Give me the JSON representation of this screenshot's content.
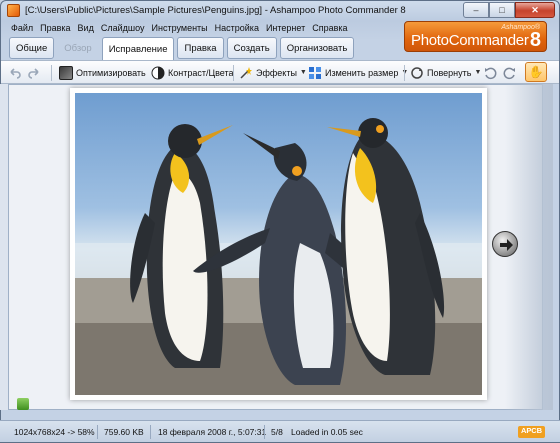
{
  "window": {
    "title": "[C:\\Users\\Public\\Pictures\\Sample Pictures\\Penguins.jpg] - Ashampoo Photo Commander 8",
    "controls": {
      "minimize": "‒",
      "maximize": "□",
      "close": "✕"
    }
  },
  "menu": {
    "items": [
      "Файл",
      "Правка",
      "Вид",
      "Слайдшоу",
      "Инструменты",
      "Настройка",
      "Интернет",
      "Справка"
    ]
  },
  "tabs": [
    {
      "label": "Общие",
      "state": "normal"
    },
    {
      "label": "Обзор",
      "state": "disabled"
    },
    {
      "label": "Исправление",
      "state": "active"
    },
    {
      "label": "Правка",
      "state": "normal"
    },
    {
      "label": "Создать",
      "state": "normal"
    },
    {
      "label": "Организовать",
      "state": "normal"
    }
  ],
  "logo": {
    "brand": "Ashampoo®",
    "product": "PhotoCommander",
    "version": "8"
  },
  "toolbar": {
    "optimize": "Оптимизировать",
    "contrast": "Контраст/Цвета",
    "effects": "Эффекты",
    "resize": "Изменить размер",
    "rotate": "Повернуть"
  },
  "icons": {
    "undo": "undo-icon",
    "redo": "redo-icon",
    "optimize": "wand-icon",
    "contrast": "contrast-icon",
    "effects": "effects-icon",
    "resize": "resize-icon",
    "rotate": "rotate-icon",
    "rotate_left": "rotate-left-icon",
    "rotate_right": "rotate-right-icon",
    "hand": "hand-icon",
    "next": "next-arrow-icon"
  },
  "status": {
    "dimensions": "1024x768x24 -> 58%",
    "size": "759.60 KB",
    "date": "18 февраля 2008 г., 5:07:31",
    "position": "5/8",
    "load": "Loaded in 0.05 sec",
    "badge": "АРСВ"
  },
  "colors": {
    "accent": "#e0640c",
    "frame": "#c4d2e5",
    "sky": "#7ea9d6"
  }
}
